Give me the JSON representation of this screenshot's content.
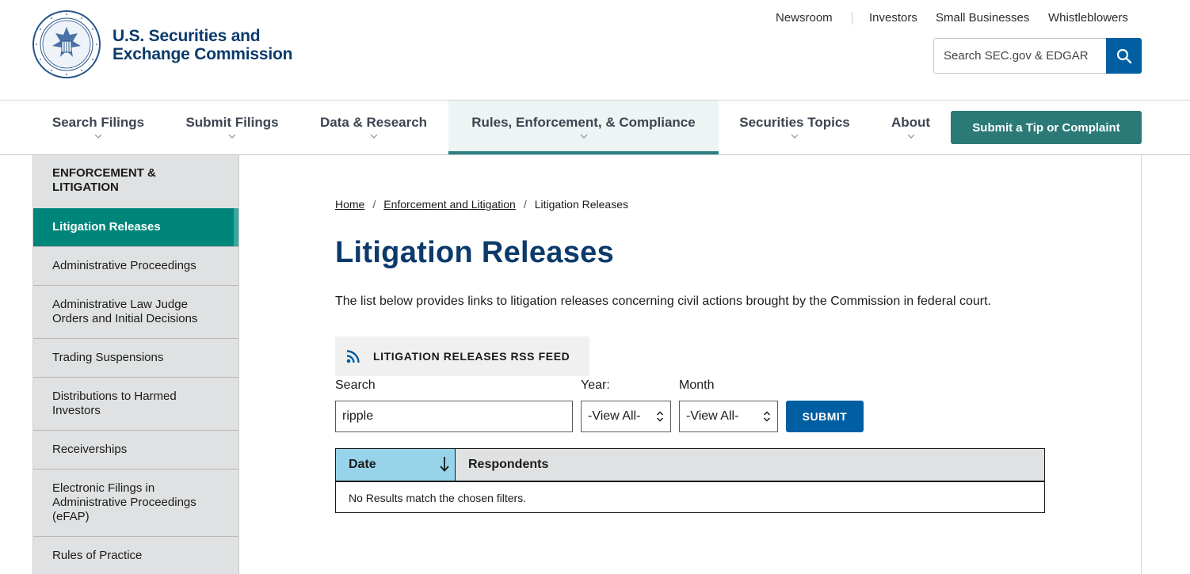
{
  "header": {
    "brand_line1": "U.S. Securities and",
    "brand_line2": "Exchange Commission",
    "utility_links": [
      "Newsroom",
      "Investors",
      "Small Businesses",
      "Whistleblowers"
    ],
    "search_placeholder": "Search SEC.gov & EDGAR"
  },
  "nav": {
    "items": [
      {
        "label": "Search Filings"
      },
      {
        "label": "Submit Filings"
      },
      {
        "label": "Data & Research"
      },
      {
        "label": "Rules, Enforcement, & Compliance",
        "active": true
      },
      {
        "label": "Securities Topics"
      },
      {
        "label": "About"
      }
    ],
    "tip_button": "Submit a Tip or Complaint"
  },
  "sidebar": {
    "heading": "ENFORCEMENT & LITIGATION",
    "items": [
      {
        "label": "Litigation Releases",
        "active": true
      },
      {
        "label": "Administrative Proceedings"
      },
      {
        "label": "Administrative Law Judge Orders and Initial Decisions"
      },
      {
        "label": "Trading Suspensions"
      },
      {
        "label": "Distributions to Harmed Investors"
      },
      {
        "label": "Receiverships"
      },
      {
        "label": "Electronic Filings in Administrative Proceedings (eFAP)"
      },
      {
        "label": "Rules of Practice"
      }
    ]
  },
  "breadcrumb": {
    "home": "Home",
    "section": "Enforcement and Litigation",
    "current": "Litigation Releases",
    "separator": "/"
  },
  "page": {
    "title": "Litigation Releases",
    "intro": "The list below provides links to litigation releases concerning civil actions brought by the Commission in federal court."
  },
  "rss": {
    "label": "LITIGATION RELEASES RSS FEED"
  },
  "filters": {
    "search_label": "Search",
    "search_value": "ripple",
    "year_label": "Year:",
    "year_value": "-View All-",
    "month_label": "Month",
    "month_value": "-View All-",
    "submit_label": "SUBMIT"
  },
  "table": {
    "columns": [
      "Date",
      "Respondents"
    ],
    "empty_message": "No Results match the chosen filters."
  },
  "colors": {
    "brand_navy": "#0b3a6b",
    "primary_blue": "#005ea2",
    "teal": "#00857b",
    "tip_green": "#2b7a78",
    "sort_header": "#97d4ea"
  },
  "icons": [
    "sec-seal-icon",
    "search-icon",
    "chevron-down-icon",
    "rss-icon",
    "sort-arrow-down-icon",
    "select-updown-icon"
  ]
}
